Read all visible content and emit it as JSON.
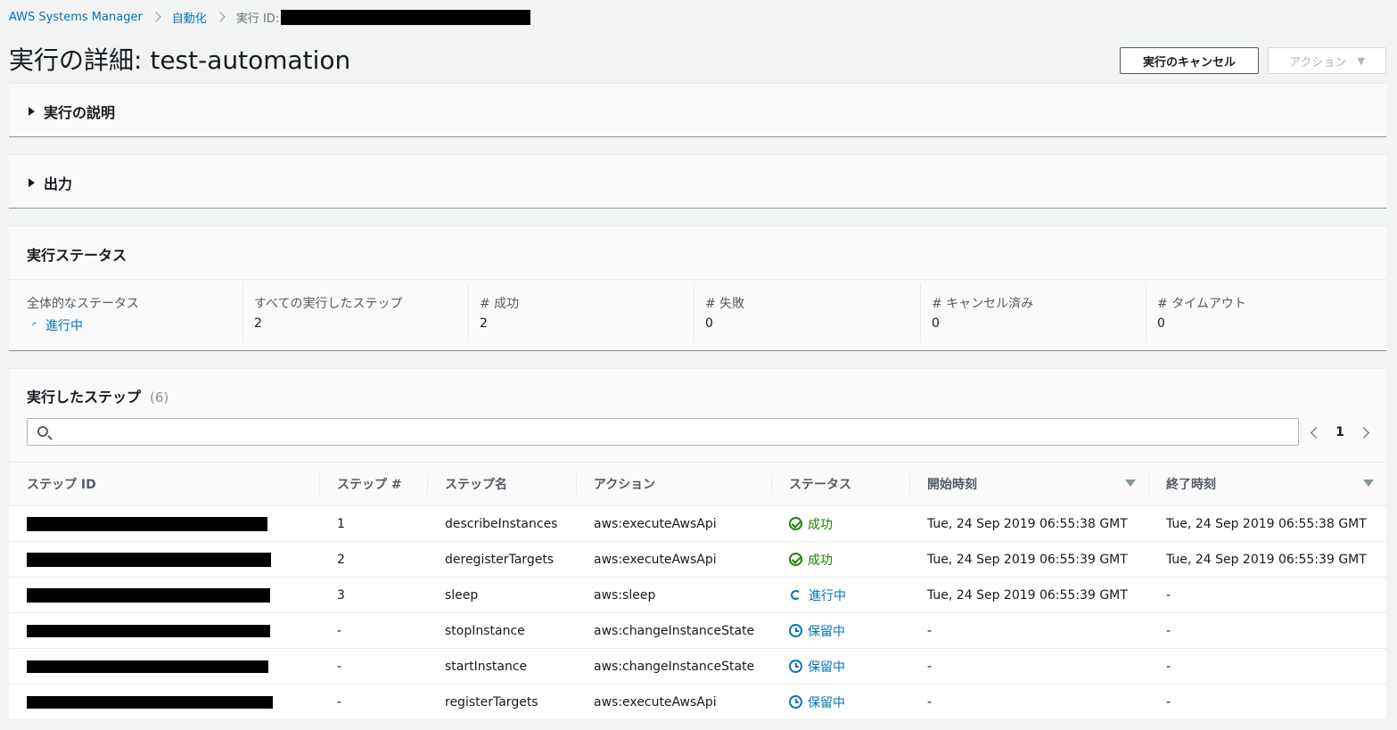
{
  "breadcrumb": {
    "service": "AWS Systems Manager",
    "section": "自動化",
    "current_label": "実行 ID:"
  },
  "header": {
    "title": "実行の詳細: test-automation",
    "cancel_button": "実行のキャンセル",
    "actions_button": "アクション",
    "actions_caret": "▼"
  },
  "description_panel": {
    "title": "実行の説明"
  },
  "output_panel": {
    "title": "出力"
  },
  "status_panel": {
    "title": "実行ステータス",
    "stats": [
      {
        "label": "全体的なステータス",
        "value": "進行中"
      },
      {
        "label": "すべての実行したステップ",
        "value": "2"
      },
      {
        "label": "# 成功",
        "value": "2"
      },
      {
        "label": "# 失敗",
        "value": "0"
      },
      {
        "label": "# キャンセル済み",
        "value": "0"
      },
      {
        "label": "# タイムアウト",
        "value": "0"
      }
    ]
  },
  "steps_panel": {
    "title": "実行したステップ",
    "count": "(6)",
    "search_placeholder": "",
    "current_page": "1",
    "columns": [
      "ステップ ID",
      "ステップ #",
      "ステップ名",
      "アクション",
      "ステータス",
      "開始時刻",
      "終了時刻"
    ],
    "rows": [
      {
        "step_num": "1",
        "name": "describeInstances",
        "action": "aws:executeAwsApi",
        "status": "成功",
        "status_kind": "success",
        "start": "Tue, 24 Sep 2019 06:55:38 GMT",
        "end": "Tue, 24 Sep 2019 06:55:38 GMT"
      },
      {
        "step_num": "2",
        "name": "deregisterTargets",
        "action": "aws:executeAwsApi",
        "status": "成功",
        "status_kind": "success",
        "start": "Tue, 24 Sep 2019 06:55:39 GMT",
        "end": "Tue, 24 Sep 2019 06:55:39 GMT"
      },
      {
        "step_num": "3",
        "name": "sleep",
        "action": "aws:sleep",
        "status": "進行中",
        "status_kind": "progress",
        "start": "Tue, 24 Sep 2019 06:55:39 GMT",
        "end": "-"
      },
      {
        "step_num": "-",
        "name": "stopInstance",
        "action": "aws:changeInstanceState",
        "status": "保留中",
        "status_kind": "pending",
        "start": "-",
        "end": "-"
      },
      {
        "step_num": "-",
        "name": "startInstance",
        "action": "aws:changeInstanceState",
        "status": "保留中",
        "status_kind": "pending",
        "start": "-",
        "end": "-"
      },
      {
        "step_num": "-",
        "name": "registerTargets",
        "action": "aws:executeAwsApi",
        "status": "保留中",
        "status_kind": "pending",
        "start": "-",
        "end": "-"
      }
    ]
  }
}
